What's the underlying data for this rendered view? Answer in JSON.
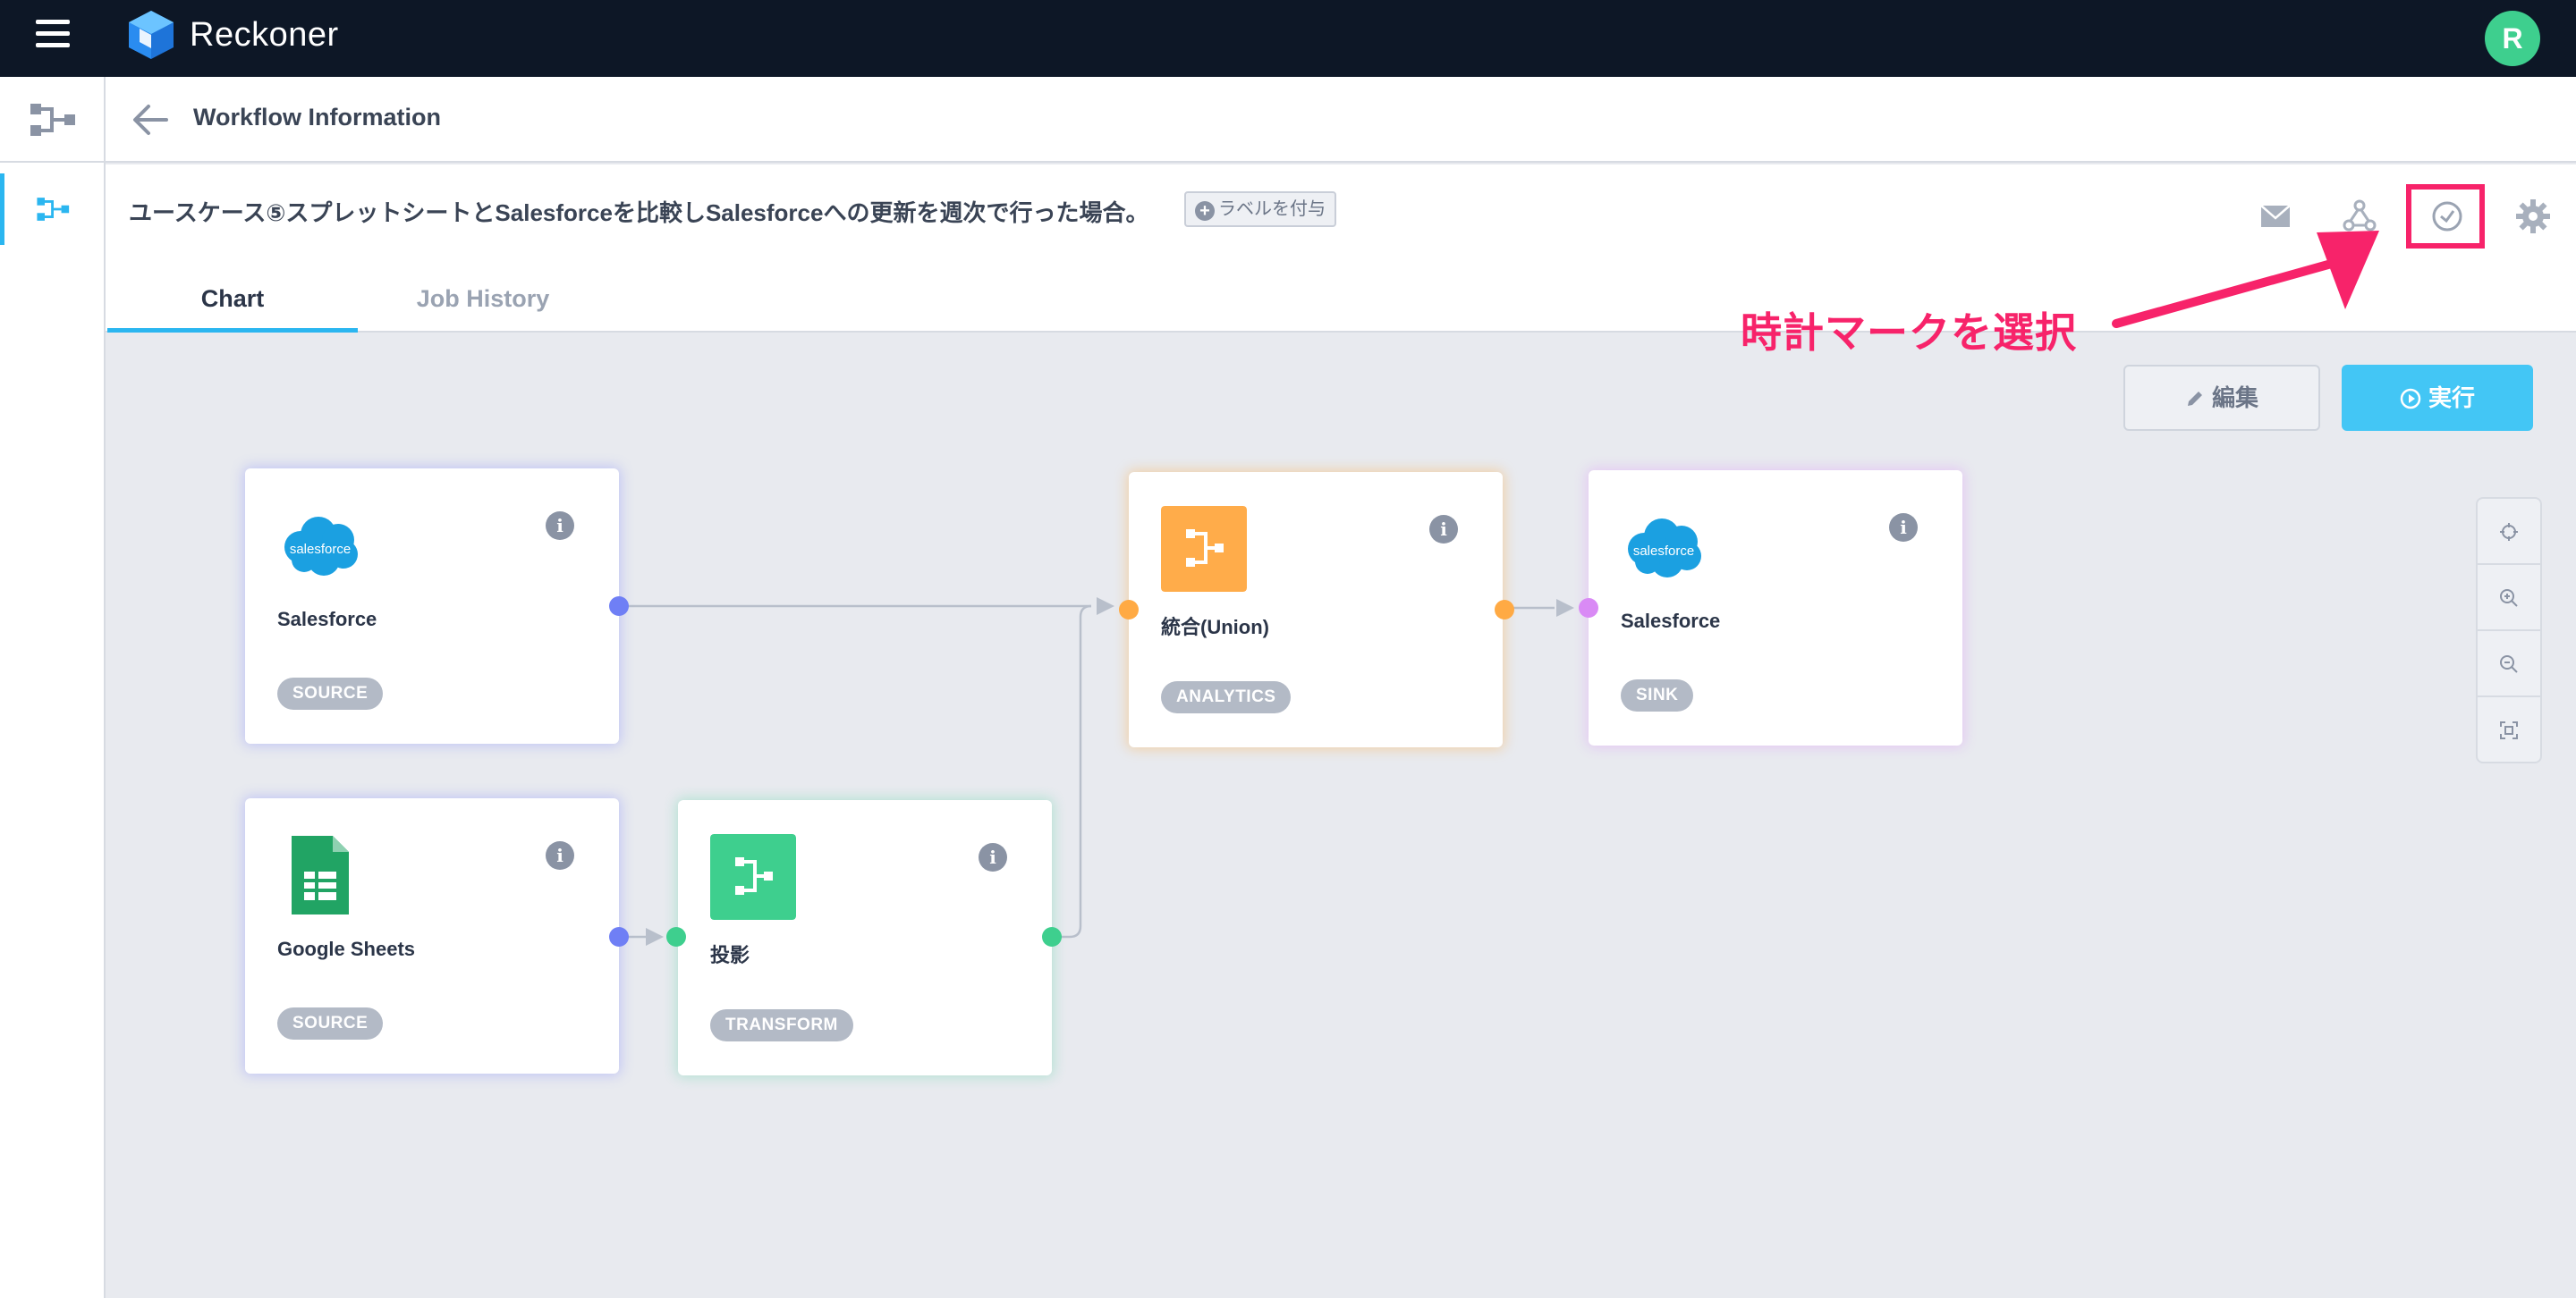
{
  "app": {
    "brand": "Reckoner",
    "avatar_letter": "R"
  },
  "subheader": {
    "title": "Workflow Information"
  },
  "workflow": {
    "title": "ユースケース⑤スプレットシートとSalesforceを比較しSalesforceへの更新を週次で行った場合。",
    "label_button": "ラベルを付与",
    "plus": "+"
  },
  "header_icons": [
    "mail-icon",
    "webhook-icon",
    "clock-icon",
    "gear-icon"
  ],
  "tabs": [
    {
      "label": "Chart",
      "active": true
    },
    {
      "label": "Job History",
      "active": false
    }
  ],
  "annotation": {
    "text": "時計マークを選択",
    "color": "#f7236a"
  },
  "actions": {
    "edit_label": "編集",
    "run_label": "実行"
  },
  "nodes": [
    {
      "id": "salesforce-source",
      "name": "Salesforce",
      "type": "SOURCE",
      "icon": "salesforce-icon",
      "logo_text": "salesforce"
    },
    {
      "id": "google-sheets-source",
      "name": "Google Sheets",
      "type": "SOURCE",
      "icon": "google-sheets-icon"
    },
    {
      "id": "projection-transform",
      "name": "投影",
      "type": "TRANSFORM",
      "icon": "flow-icon"
    },
    {
      "id": "union-analytics",
      "name": "統合(Union)",
      "type": "ANALYTICS",
      "icon": "flow-icon"
    },
    {
      "id": "salesforce-sink",
      "name": "Salesforce",
      "type": "SINK",
      "icon": "salesforce-icon",
      "logo_text": "salesforce"
    }
  ],
  "info_glyph": "i",
  "zoom_controls": [
    "locate-icon",
    "zoom-in-icon",
    "zoom-out-icon",
    "fit-icon"
  ],
  "colors": {
    "topbar": "#0d1726",
    "accent": "#2bb6f0",
    "run_button": "#43c6f5",
    "source_port": "#6f7ff5",
    "transform": "#3ecf8e",
    "analytics": "#ffaa44",
    "sink_port": "#d98af5",
    "highlight": "#f7236a"
  }
}
